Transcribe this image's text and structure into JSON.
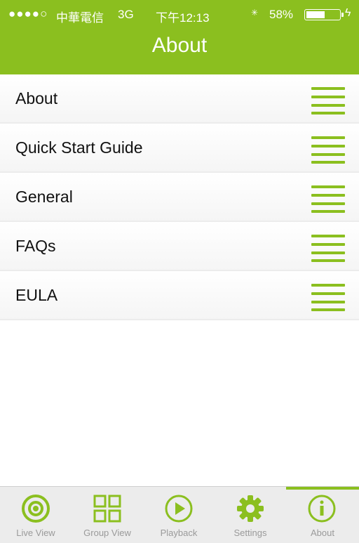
{
  "status_bar": {
    "signal": "●●●●○",
    "carrier": "中華電信",
    "network": "3G",
    "time": "下午12:13",
    "battery_percent": "58%",
    "battery_level": 0.58
  },
  "header": {
    "title": "About"
  },
  "menu": {
    "items": [
      {
        "label": "About"
      },
      {
        "label": "Quick Start Guide"
      },
      {
        "label": "General"
      },
      {
        "label": "FAQs"
      },
      {
        "label": "EULA"
      }
    ]
  },
  "tabbar": {
    "tabs": [
      {
        "label": "Live View",
        "icon": "live-view-icon"
      },
      {
        "label": "Group View",
        "icon": "grid-icon"
      },
      {
        "label": "Playback",
        "icon": "play-icon"
      },
      {
        "label": "Settings",
        "icon": "gear-icon"
      },
      {
        "label": "About",
        "icon": "info-icon"
      }
    ],
    "active_index": 4
  },
  "colors": {
    "accent": "#8bbf1f",
    "tabbar_bg": "#ececec",
    "tab_label": "#9a9a9a"
  }
}
